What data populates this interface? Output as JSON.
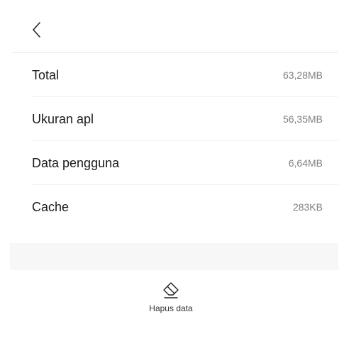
{
  "header": {
    "back_icon": "chevron-left-icon"
  },
  "storage": {
    "rows": [
      {
        "label": "Total",
        "value": "63,28MB"
      },
      {
        "label": "Ukuran apl",
        "value": "56,35MB"
      },
      {
        "label": "Data pengguna",
        "value": "6,64MB"
      },
      {
        "label": "Cache",
        "value": "283KB"
      }
    ]
  },
  "actions": {
    "clear_data_label": "Hapus data",
    "clear_data_icon": "eraser-icon"
  }
}
